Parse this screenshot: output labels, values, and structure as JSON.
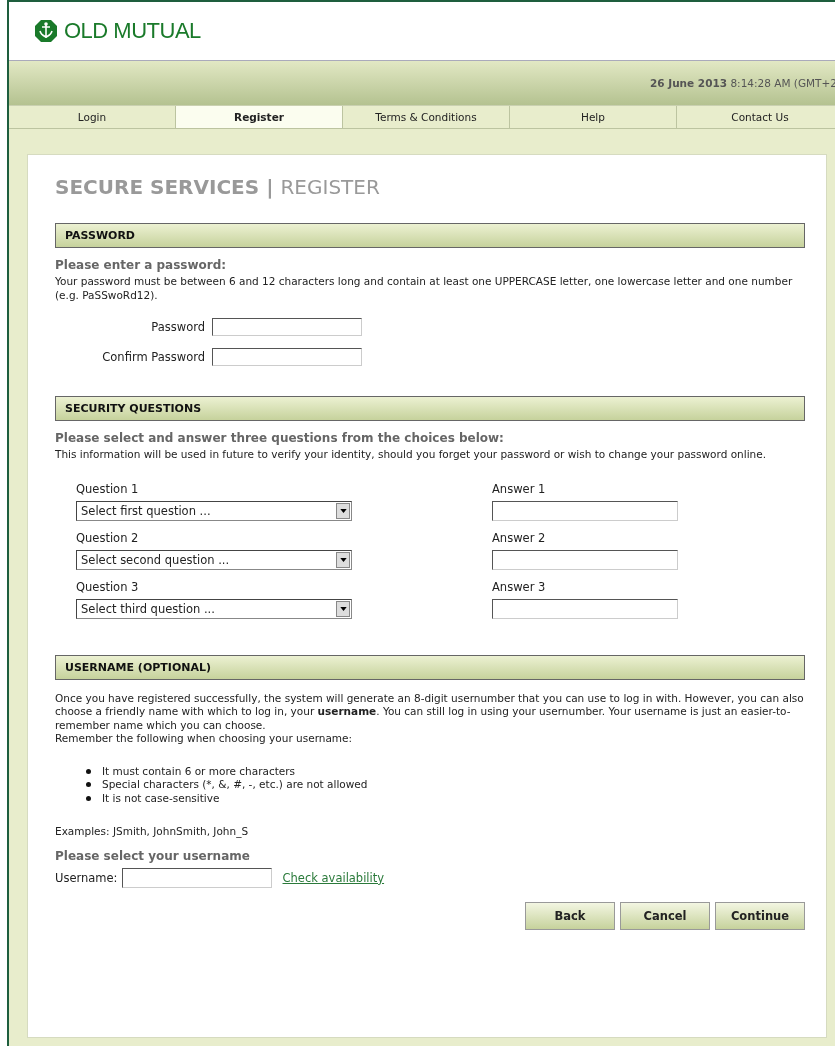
{
  "logo": {
    "text": "OLD MUTUAL"
  },
  "datetime": "**26 June 2013** 8:14:28 AM (GMT+2",
  "tabs": [
    {
      "label": "Login",
      "selected": false
    },
    {
      "label": "Register",
      "selected": true
    },
    {
      "label": "Terms & Conditions",
      "selected": false
    },
    {
      "label": "Help",
      "selected": false
    },
    {
      "label": "Contact Us",
      "selected": false
    }
  ],
  "page_title": {
    "main": "SECURE SERVICES",
    "separator": "|",
    "sub": "REGISTER"
  },
  "password_section": {
    "heading": "PASSWORD",
    "prompt": "Please enter a password:",
    "info": "Your password must be between 6 and 12 characters long and contain at least one UPPERCASE letter, one lowercase letter and one number (e.g. PaSSwoRd12).",
    "fields": [
      {
        "label": "Password"
      },
      {
        "label": "Confirm Password"
      }
    ]
  },
  "security_section": {
    "heading": "SECURITY QUESTIONS",
    "prompt": "Please select and answer three questions from the choices below:",
    "info": "This information will be used in future to verify your identity, should you forget your password or wish to change your password online.",
    "rows": [
      {
        "question_label": "Question 1",
        "question_value": "Select first question ...",
        "answer_label": "Answer 1"
      },
      {
        "question_label": "Question 2",
        "question_value": "Select second question ...",
        "answer_label": "Answer 2"
      },
      {
        "question_label": "Question 3",
        "question_value": "Select third question ...",
        "answer_label": "Answer 3"
      }
    ]
  },
  "username_section": {
    "heading": "USERNAME (OPTIONAL)",
    "info": "Once you have registered successfully, the system will generate an 8-digit usernumber that you can use to log in with. However, you can also choose a friendly name with which to log in, your **username**. You can still log in using your usernumber. Your username is just an easier-to-remember name which you can choose.",
    "remember": "Remember the following when choosing your username:",
    "rules": [
      "It must contain 6 or more characters",
      "Special characters (*, &, #, -, etc.) are not allowed",
      "It is not case-sensitive"
    ],
    "examples": "Examples: JSmith, JohnSmith, John_S",
    "prompt": "Please select your username",
    "field_label": "Username:",
    "link": "Check availability"
  },
  "buttons": [
    "Back",
    "Cancel",
    "Continue"
  ]
}
